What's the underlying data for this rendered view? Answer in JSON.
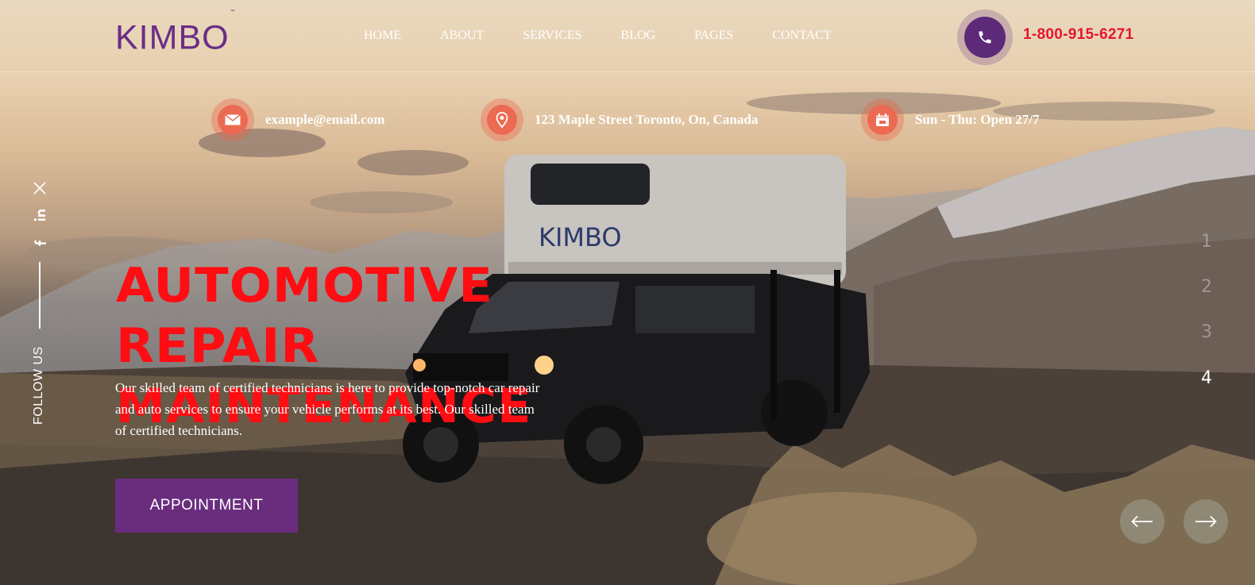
{
  "brand": {
    "name": "KIMBO",
    "trademark": "™",
    "truck_text": "KIMBO"
  },
  "nav": {
    "items": [
      {
        "label": "HOME"
      },
      {
        "label": "ABOUT"
      },
      {
        "label": "SERVICES"
      },
      {
        "label": "BLOG"
      },
      {
        "label": "PAGES"
      },
      {
        "label": "CONTACT"
      }
    ]
  },
  "contact": {
    "phone": "1-800-915-6271",
    "phone_icon": "phone-icon"
  },
  "info_bar": {
    "email": {
      "icon": "email-icon",
      "text": "example@email.com"
    },
    "address": {
      "icon": "location-pin-icon",
      "text": "123 Maple Street Toronto, On, Canada"
    },
    "hours": {
      "icon": "calendar-icon",
      "text": "Sun - Thu: Open 27/7"
    }
  },
  "social": {
    "icons": [
      "x-twitter-icon",
      "linkedin-icon",
      "facebook-icon"
    ],
    "label": "FOLLOW US"
  },
  "hero": {
    "headline_line1": "AUTOMOTIVE REPAIR",
    "headline_line2": "MAINTENANCE",
    "description": "Our skilled team of certified technicians is here to provide top-notch car repair and auto services to ensure your vehicle performs at its best. Our skilled team of certified technicians.",
    "cta_label": "APPOINTMENT"
  },
  "slider": {
    "numbers": [
      "1",
      "2",
      "3",
      "4"
    ],
    "active_index": 3,
    "prev_icon": "arrow-left-icon",
    "next_icon": "arrow-right-icon"
  },
  "colors": {
    "brand_purple": "#6a2d7e",
    "headline_red": "#ff0d13",
    "phone_red": "#e4162b",
    "icon_coral": "#ec6a52"
  }
}
